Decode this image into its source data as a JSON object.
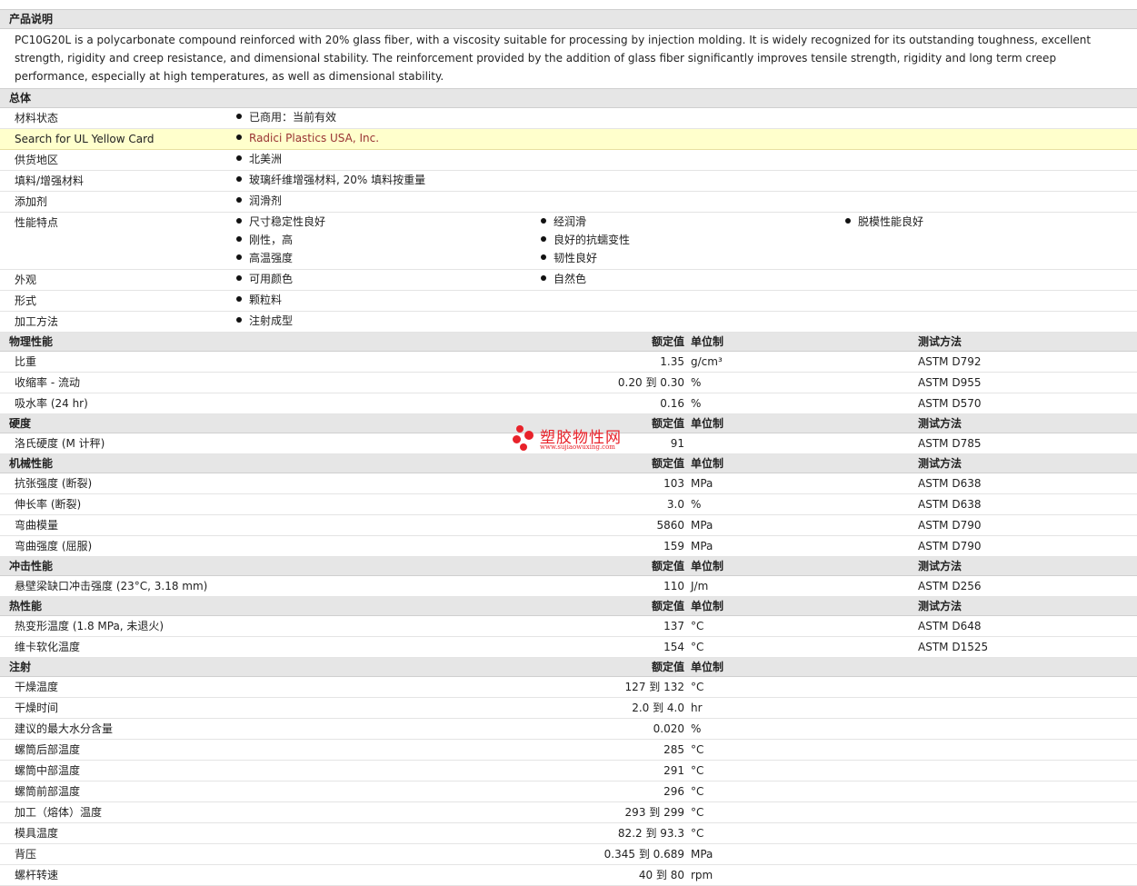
{
  "product_description": {
    "title": "产品说明",
    "text": "PC10G20L is a polycarbonate compound reinforced with 20% glass fiber, with a viscosity suitable for processing by injection molding. It is widely recognized for its outstanding toughness, excellent strength, rigidity and creep resistance, and dimensional stability. The reinforcement provided by the addition of glass fiber significantly improves tensile strength, rigidity and long term creep performance, especially at high temperatures, as well as dimensional stability."
  },
  "general": {
    "title": "总体",
    "rows": [
      {
        "label": "材料状态",
        "items": [
          "已商用：当前有效"
        ]
      },
      {
        "label": "Search for UL Yellow Card",
        "items": [
          "Radici Plastics USA, Inc."
        ]
      },
      {
        "label": "供货地区",
        "items": [
          "北美洲"
        ]
      },
      {
        "label": "填料/增强材料",
        "items": [
          "玻璃纤维增强材料, 20% 填料按重量"
        ]
      },
      {
        "label": "添加剂",
        "items": [
          "润滑剂"
        ]
      },
      {
        "label": "性能特点",
        "col1": [
          "尺寸稳定性良好",
          "刚性，高",
          "高温强度"
        ],
        "col2": [
          "经润滑",
          "良好的抗蠕变性",
          "韧性良好"
        ],
        "col3": [
          "脱模性能良好"
        ]
      },
      {
        "label": "外观",
        "col1": [
          "可用颜色"
        ],
        "col2": [
          "自然色"
        ]
      },
      {
        "label": "形式",
        "items": [
          "颗粒料"
        ]
      },
      {
        "label": "加工方法",
        "items": [
          "注射成型"
        ]
      }
    ]
  },
  "headers": {
    "value": "额定值",
    "unit": "单位制",
    "method": "测试方法"
  },
  "sections": [
    {
      "title": "物理性能",
      "show_method": true,
      "rows": [
        {
          "label": "比重",
          "value": "1.35",
          "unit": "g/cm³",
          "method": "ASTM D792"
        },
        {
          "label": "收缩率  - 流动",
          "value": "0.20 到  0.30",
          "unit": "%",
          "method": "ASTM D955"
        },
        {
          "label": "吸水率  (24 hr)",
          "value": "0.16",
          "unit": "%",
          "method": "ASTM D570"
        }
      ]
    },
    {
      "title": "硬度",
      "show_method": true,
      "rows": [
        {
          "label": "洛氏硬度  (M 计秤)",
          "value": "91",
          "unit": "",
          "method": "ASTM D785"
        }
      ]
    },
    {
      "title": "机械性能",
      "show_method": true,
      "rows": [
        {
          "label": "抗张强度  (断裂)",
          "value": "103",
          "unit": "MPa",
          "method": "ASTM D638"
        },
        {
          "label": "伸长率  (断裂)",
          "value": "3.0",
          "unit": "%",
          "method": "ASTM D638"
        },
        {
          "label": "弯曲模量",
          "value": "5860",
          "unit": "MPa",
          "method": "ASTM D790"
        },
        {
          "label": "弯曲强度  (屈服)",
          "value": "159",
          "unit": "MPa",
          "method": "ASTM D790"
        }
      ]
    },
    {
      "title": "冲击性能",
      "show_method": true,
      "rows": [
        {
          "label": "悬壁梁缺口冲击强度  (23°C, 3.18 mm)",
          "value": "110",
          "unit": "J/m",
          "method": "ASTM D256"
        }
      ]
    },
    {
      "title": "热性能",
      "show_method": true,
      "rows": [
        {
          "label": "热变形温度  (1.8 MPa, 未退火)",
          "value": "137",
          "unit": "°C",
          "method": "ASTM D648"
        },
        {
          "label": "维卡软化温度",
          "value": "154",
          "unit": "°C",
          "method": "ASTM D1525"
        }
      ]
    },
    {
      "title": "注射",
      "show_method": false,
      "rows": [
        {
          "label": "干燥温度",
          "value": "127 到  132",
          "unit": "°C",
          "method": ""
        },
        {
          "label": "干燥时间",
          "value": "2.0 到  4.0",
          "unit": "hr",
          "method": ""
        },
        {
          "label": "建议的最大水分含量",
          "value": "0.020",
          "unit": "%",
          "method": ""
        },
        {
          "label": "螺筒后部温度",
          "value": "285",
          "unit": "°C",
          "method": ""
        },
        {
          "label": "螺筒中部温度",
          "value": "291",
          "unit": "°C",
          "method": ""
        },
        {
          "label": "螺筒前部温度",
          "value": "296",
          "unit": "°C",
          "method": ""
        },
        {
          "label": "加工（熔体）温度",
          "value": "293 到  299",
          "unit": "°C",
          "method": ""
        },
        {
          "label": "模具温度",
          "value": "82.2 到  93.3",
          "unit": "°C",
          "method": ""
        },
        {
          "label": "背压",
          "value": "0.345 到  0.689",
          "unit": "MPa",
          "method": ""
        },
        {
          "label": "螺杆转速",
          "value": "40 到  80",
          "unit": "rpm",
          "method": ""
        }
      ]
    }
  ],
  "watermark": {
    "name": "塑胶物性网",
    "url": "www.sujiaowuxing.com",
    "color": "#e8222a"
  }
}
